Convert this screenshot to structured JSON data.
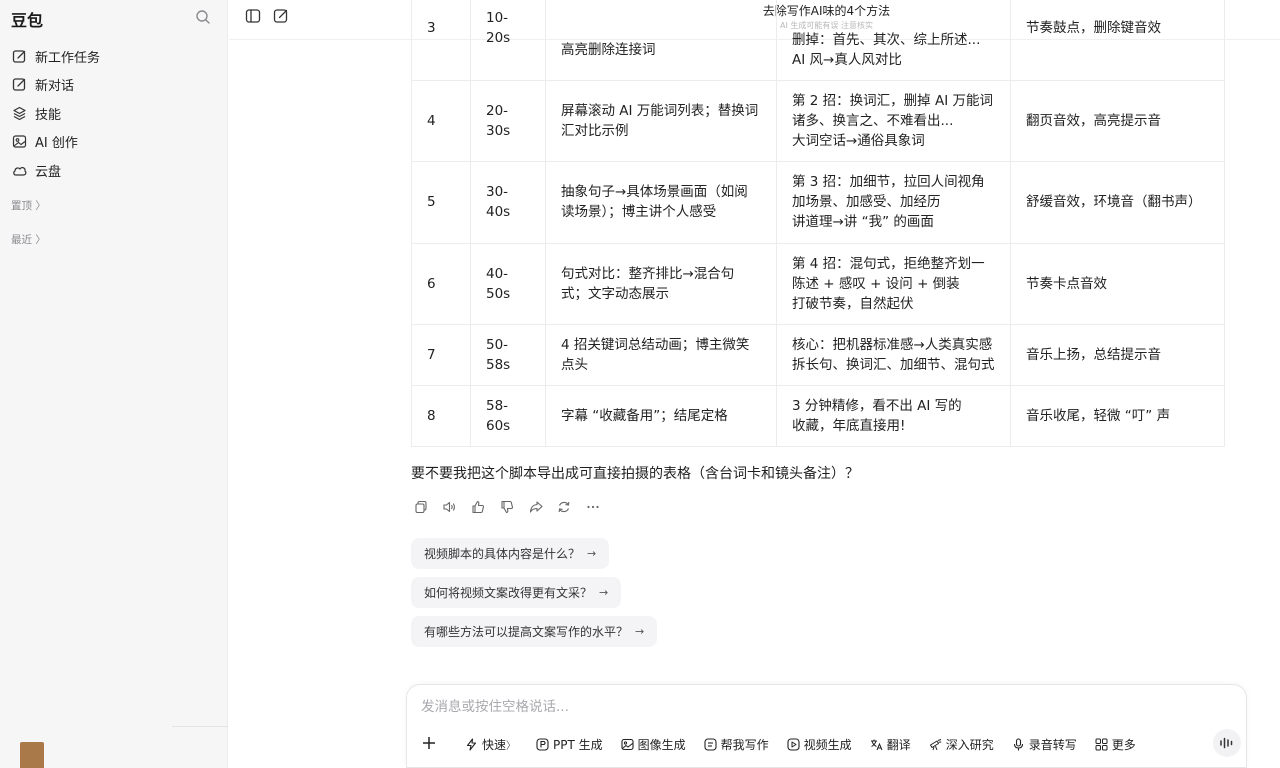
{
  "app": {
    "name": "豆包"
  },
  "sidebar": {
    "items": [
      {
        "label": "新工作任务",
        "icon": "edit-icon"
      },
      {
        "label": "新对话",
        "icon": "new-chat-icon"
      },
      {
        "label": "技能",
        "icon": "layers-icon"
      },
      {
        "label": "AI 创作",
        "icon": "image-icon"
      },
      {
        "label": "云盘",
        "icon": "cloud-icon"
      }
    ],
    "pinned_label": "置顶",
    "recent_label": "最近"
  },
  "topbar": {
    "title": "去除写作AI味的4个方法",
    "subtitle": "AI 生成可能有误 注意核实"
  },
  "table": {
    "rows": [
      {
        "num": "3",
        "time": "10-20s",
        "visual": "高亮删除连接词",
        "text": "删掉：首先、其次、综上所述...\nAI 风→真人风对比",
        "audio": "节奏鼓点，删除键音效"
      },
      {
        "num": "4",
        "time": "20-30s",
        "visual": "屏幕滚动 AI 万能词列表；替换词汇对比示例",
        "text": "第 2 招：换词汇，删掉 AI 万能词\n诸多、换言之、不难看出...\n大词空话→通俗具象词",
        "audio": "翻页音效，高亮提示音"
      },
      {
        "num": "5",
        "time": "30-40s",
        "visual": "抽象句子→具体场景画面（如阅读场景）；博主讲个人感受",
        "text": "第 3 招：加细节，拉回人间视角\n加场景、加感受、加经历\n讲道理→讲 “我” 的画面",
        "audio": "舒缓音效，环境音（翻书声）"
      },
      {
        "num": "6",
        "time": "40-50s",
        "visual": "句式对比：整齐排比→混合句式；文字动态展示",
        "text": "第 4 招：混句式，拒绝整齐划一\n陈述 + 感叹 + 设问 + 倒装\n打破节奏，自然起伏",
        "audio": "节奏卡点音效"
      },
      {
        "num": "7",
        "time": "50-58s",
        "visual": "4 招关键词总结动画；博主微笑点头",
        "text": "核心：把机器标准感→人类真实感\n拆长句、换词汇、加细节、混句式",
        "audio": "音乐上扬，总结提示音"
      },
      {
        "num": "8",
        "time": "58-60s",
        "visual": "字幕 “收藏备用”；结尾定格",
        "text": "3 分钟精修，看不出 AI 写的\n收藏，年底直接用!",
        "audio": "音乐收尾，轻微 “叮” 声"
      }
    ]
  },
  "question": "要不要我把这个脚本导出成可直接拍摄的表格（含台词卡和镜头备注）？",
  "actions": [
    "copy-icon",
    "speaker-icon",
    "thumbs-up-icon",
    "thumbs-down-icon",
    "share-icon",
    "regenerate-icon",
    "more-icon"
  ],
  "suggestions": [
    "视频脚本的具体内容是什么？",
    "如何将视频文案改得更有文采？",
    "有哪些方法可以提高文案写作的水平？"
  ],
  "suggestion_arrow": "→",
  "composer": {
    "placeholder": "发消息或按住空格说话...",
    "tools": [
      {
        "label": "快速",
        "icon": "lightning-icon",
        "suffix": "〉"
      },
      {
        "label": "PPT 生成",
        "icon": "ppt-icon"
      },
      {
        "label": "图像生成",
        "icon": "image-gen-icon"
      },
      {
        "label": "帮我写作",
        "icon": "write-icon"
      },
      {
        "label": "视频生成",
        "icon": "video-icon"
      },
      {
        "label": "翻译",
        "icon": "translate-icon"
      },
      {
        "label": "深入研究",
        "icon": "research-icon"
      },
      {
        "label": "录音转写",
        "icon": "mic-icon"
      },
      {
        "label": "更多",
        "icon": "grid-icon"
      }
    ]
  }
}
